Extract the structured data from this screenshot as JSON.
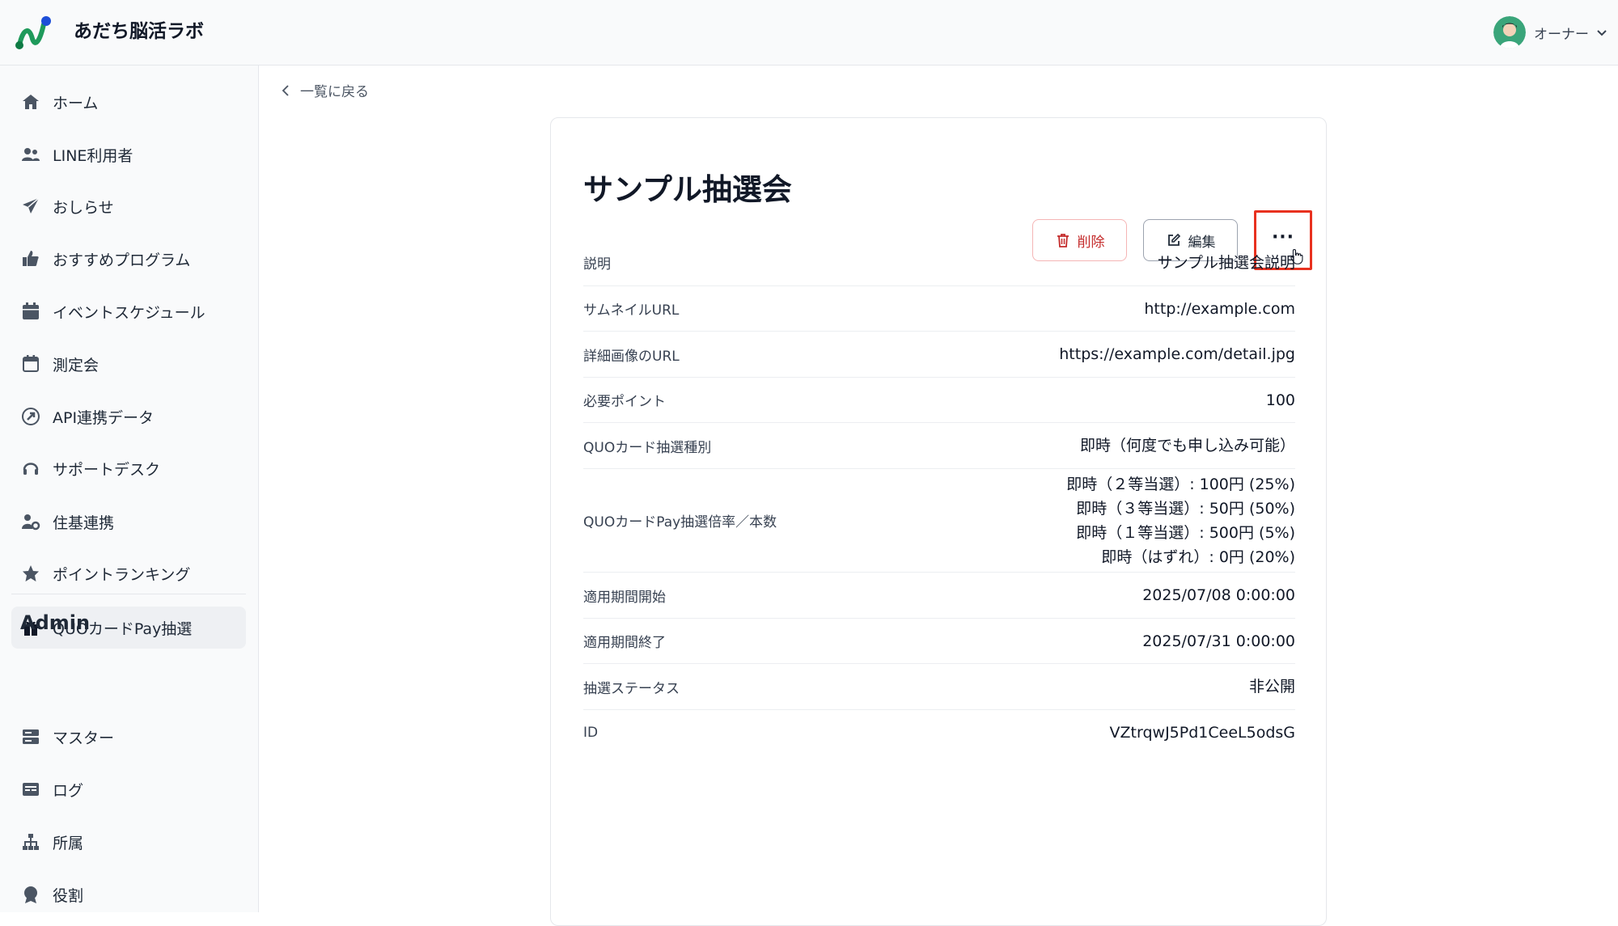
{
  "app": {
    "title": "あだち脳活ラボ"
  },
  "user": {
    "name": "オーナー"
  },
  "sidebar": {
    "items": [
      {
        "label": "ホーム",
        "icon": "home-icon"
      },
      {
        "label": "LINE利用者",
        "icon": "users-icon"
      },
      {
        "label": "おしらせ",
        "icon": "paper-plane-icon"
      },
      {
        "label": "おすすめプログラム",
        "icon": "thumbs-up-icon"
      },
      {
        "label": "イベントスケジュール",
        "icon": "calendar-icon"
      },
      {
        "label": "測定会",
        "icon": "calendar-blank-icon"
      },
      {
        "label": "API連携データ",
        "icon": "api-icon"
      },
      {
        "label": "サポートデスク",
        "icon": "headset-icon"
      },
      {
        "label": "住基連携",
        "icon": "user-gear-icon"
      },
      {
        "label": "ポイントランキング",
        "icon": "star-icon"
      },
      {
        "label": "QUOカードPay抽選",
        "icon": "gift-icon",
        "active": true
      }
    ],
    "admin_title": "Admin",
    "admin_items": [
      {
        "label": "マスター",
        "icon": "server-icon"
      },
      {
        "label": "ログ",
        "icon": "log-icon"
      },
      {
        "label": "所属",
        "icon": "org-chart-icon"
      },
      {
        "label": "役割",
        "icon": "badge-icon"
      }
    ]
  },
  "main": {
    "back_label": "一覧に戻る",
    "title": "サンプル抽選会",
    "delete_label": "削除",
    "edit_label": "編集",
    "more_label": "···",
    "rows": [
      {
        "label": "説明",
        "value": "サンプル抽選会説明"
      },
      {
        "label": "サムネイルURL",
        "value": "http://example.com"
      },
      {
        "label": "詳細画像のURL",
        "value": "https://example.com/detail.jpg"
      },
      {
        "label": "必要ポイント",
        "value": "100"
      },
      {
        "label": "QUOカード抽選種別",
        "value": "即時（何度でも申し込み可能）"
      },
      {
        "label": "QUOカードPay抽選倍率／本数",
        "values": [
          "即時（２等当選）: 100円 (25%)",
          "即時（３等当選）: 50円 (50%)",
          "即時（１等当選）: 500円 (5%)",
          "即時（はずれ）: 0円 (20%)"
        ]
      },
      {
        "label": "適用期間開始",
        "value": "2025/07/08 0:00:00"
      },
      {
        "label": "適用期間終了",
        "value": "2025/07/31 0:00:00"
      },
      {
        "label": "抽選ステータス",
        "value": "非公開"
      },
      {
        "label": "ID",
        "value": "VZtrqwJ5Pd1CeeL5odsG"
      }
    ]
  },
  "colors": {
    "accent_red": "#e8311f",
    "delete_red": "#c42b2b",
    "logo_green": "#1f9a5b",
    "logo_blue": "#1d4ed8"
  }
}
